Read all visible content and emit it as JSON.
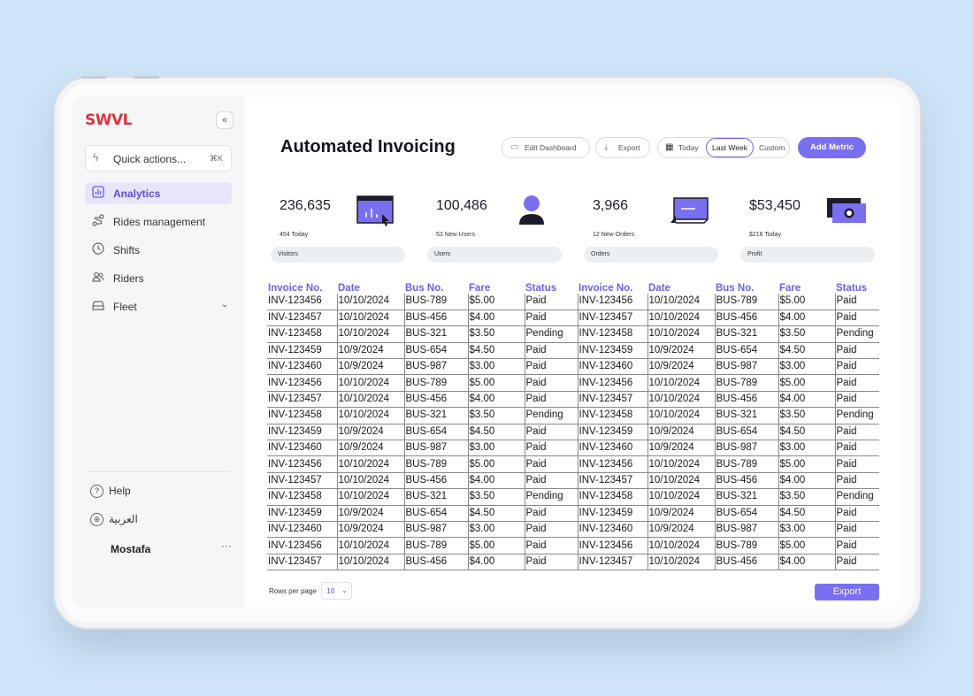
{
  "sidebar": {
    "logo": "SWVL",
    "quick_actions": {
      "label": "Quick actions...",
      "shortcut": "⌘K"
    },
    "items": [
      {
        "label": "Analytics",
        "icon": "chart-icon",
        "active": true
      },
      {
        "label": "Rides management",
        "icon": "route-icon"
      },
      {
        "label": "Shifts",
        "icon": "clock-icon"
      },
      {
        "label": "Riders",
        "icon": "users-icon"
      },
      {
        "label": "Fleet",
        "icon": "bus-icon"
      }
    ],
    "footer": {
      "help": "Help",
      "language": "العربية",
      "user": "Mostafa",
      "more": "···"
    }
  },
  "header": {
    "title": "Automated Invoicing",
    "edit_dashboard": "Edit Dashboard",
    "export": "Export",
    "range": {
      "today": "Today",
      "last_week": "Last Week",
      "custom": "Custom",
      "selected": "Last Week"
    },
    "add_metric": "Add Metric"
  },
  "metrics": [
    {
      "value": "236,635",
      "sub": "454 Today",
      "label": "Visitors"
    },
    {
      "value": "100,486",
      "sub": "53 New Users",
      "label": "Users"
    },
    {
      "value": "3,966",
      "sub": "12 New Orders",
      "label": "Orders"
    },
    {
      "value": "$53,450",
      "sub": "$216 Today",
      "label": "Profit"
    }
  ],
  "table": {
    "columns": [
      "Invoice No.",
      "Date",
      "Bus No.",
      "Fare",
      "Status"
    ],
    "rows": [
      [
        "INV-123456",
        "10/10/2024",
        "BUS-789",
        "$5.00",
        "Paid"
      ],
      [
        "INV-123457",
        "10/10/2024",
        "BUS-456",
        "$4.00",
        "Paid"
      ],
      [
        "INV-123458",
        "10/10/2024",
        "BUS-321",
        "$3.50",
        "Pending"
      ],
      [
        "INV-123459",
        "10/9/2024",
        "BUS-654",
        "$4.50",
        "Paid"
      ],
      [
        "INV-123460",
        "10/9/2024",
        "BUS-987",
        "$3.00",
        "Paid"
      ],
      [
        "INV-123456",
        "10/10/2024",
        "BUS-789",
        "$5.00",
        "Paid"
      ],
      [
        "INV-123457",
        "10/10/2024",
        "BUS-456",
        "$4.00",
        "Paid"
      ],
      [
        "INV-123458",
        "10/10/2024",
        "BUS-321",
        "$3.50",
        "Pending"
      ],
      [
        "INV-123459",
        "10/9/2024",
        "BUS-654",
        "$4.50",
        "Paid"
      ],
      [
        "INV-123460",
        "10/9/2024",
        "BUS-987",
        "$3.00",
        "Paid"
      ],
      [
        "INV-123456",
        "10/10/2024",
        "BUS-789",
        "$5.00",
        "Paid"
      ],
      [
        "INV-123457",
        "10/10/2024",
        "BUS-456",
        "$4.00",
        "Paid"
      ],
      [
        "INV-123458",
        "10/10/2024",
        "BUS-321",
        "$3.50",
        "Pending"
      ],
      [
        "INV-123459",
        "10/9/2024",
        "BUS-654",
        "$4.50",
        "Paid"
      ],
      [
        "INV-123460",
        "10/9/2024",
        "BUS-987",
        "$3.00",
        "Paid"
      ],
      [
        "INV-123456",
        "10/10/2024",
        "BUS-789",
        "$5.00",
        "Paid"
      ],
      [
        "INV-123457",
        "10/10/2024",
        "BUS-456",
        "$4.00",
        "Paid"
      ]
    ]
  },
  "footer": {
    "rows_per_page_label": "Rows per page",
    "rows_per_page_value": "10",
    "export": "Export"
  },
  "colors": {
    "accent": "#7a6ff0",
    "brand": "#e0313c",
    "active_bg": "#e6e5fa"
  }
}
